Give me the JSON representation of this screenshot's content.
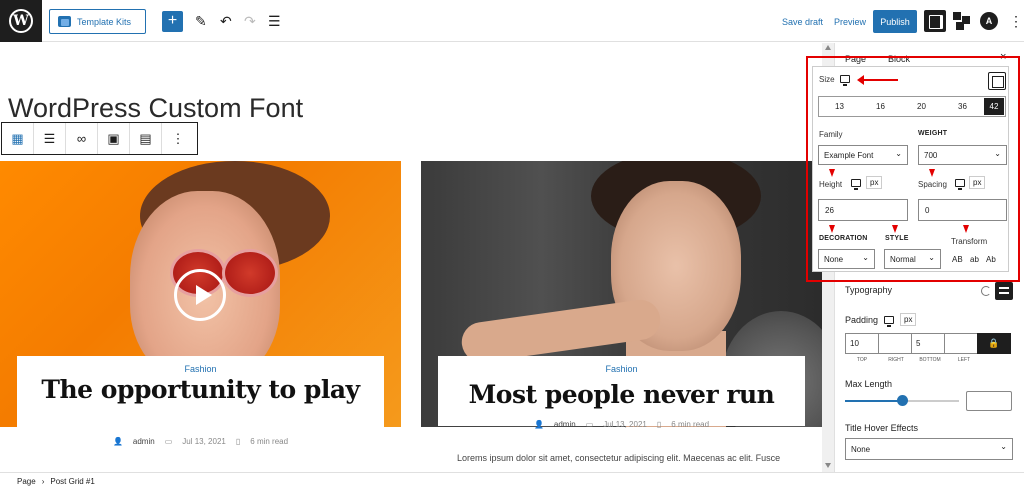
{
  "topbar": {
    "template_kits_label": "Template Kits",
    "add_label": "+",
    "save_draft_label": "Save draft",
    "preview_label": "Preview",
    "publish_label": "Publish",
    "more_label": "⋮"
  },
  "canvas": {
    "page_title": "WordPress Custom Font",
    "posts": [
      {
        "category": "Fashion",
        "title": "The opportunity to play",
        "author": "admin",
        "date": "Jul 13, 2021",
        "read_time": "6 min read"
      },
      {
        "category": "Fashion",
        "title": "Most people never run",
        "author": "admin",
        "date": "Jul 13, 2021",
        "read_time": "6 min read",
        "excerpt": "Lorems ipsum dolor sit amet, consectetur adipiscing elit. Maecenas ac elit. Fusce"
      }
    ]
  },
  "sidebar": {
    "tabs": [
      "Page",
      "Block"
    ],
    "close_label": "×",
    "typography_popup": {
      "size_label": "Size",
      "size_options": [
        "13",
        "16",
        "20",
        "36",
        "42"
      ],
      "size_selected": "42",
      "family_label": "Family",
      "family_value": "Example Font",
      "weight_label": "WEIGHT",
      "weight_value": "700",
      "height_label": "Height",
      "height_unit": "px",
      "height_value": "26",
      "spacing_label": "Spacing",
      "spacing_unit": "px",
      "spacing_value": "0",
      "decoration_label": "DECORATION",
      "decoration_value": "None",
      "style_label": "STYLE",
      "style_value": "Normal",
      "transform_label": "Transform",
      "transform_options": [
        "AB",
        "ab",
        "Ab"
      ]
    },
    "typography_label": "Typography",
    "padding": {
      "label": "Padding",
      "unit": "px",
      "top": "10",
      "right": "",
      "bottom": "5",
      "left": "",
      "sub_labels": [
        "TOP",
        "RIGHT",
        "BOTTOM",
        "LEFT"
      ]
    },
    "max_length_label": "Max Length",
    "max_length_slider_fraction": 0.5,
    "title_hover_label": "Title Hover Effects",
    "title_hover_value": "None"
  },
  "footer": {
    "breadcrumb": [
      "Page",
      "Post Grid #1"
    ]
  },
  "colors": {
    "accent": "#2271b1",
    "highlight": "#e30000",
    "dark": "#1e1e1e"
  },
  "icons": [
    "wordpress-logo-icon",
    "template-kits-icon",
    "pen-icon",
    "undo-icon",
    "redo-icon",
    "list-view-icon",
    "settings-panel-icon",
    "blocks-icon",
    "astra-icon",
    "more-icon",
    "monitor-icon",
    "reset-icon",
    "lock-icon"
  ]
}
